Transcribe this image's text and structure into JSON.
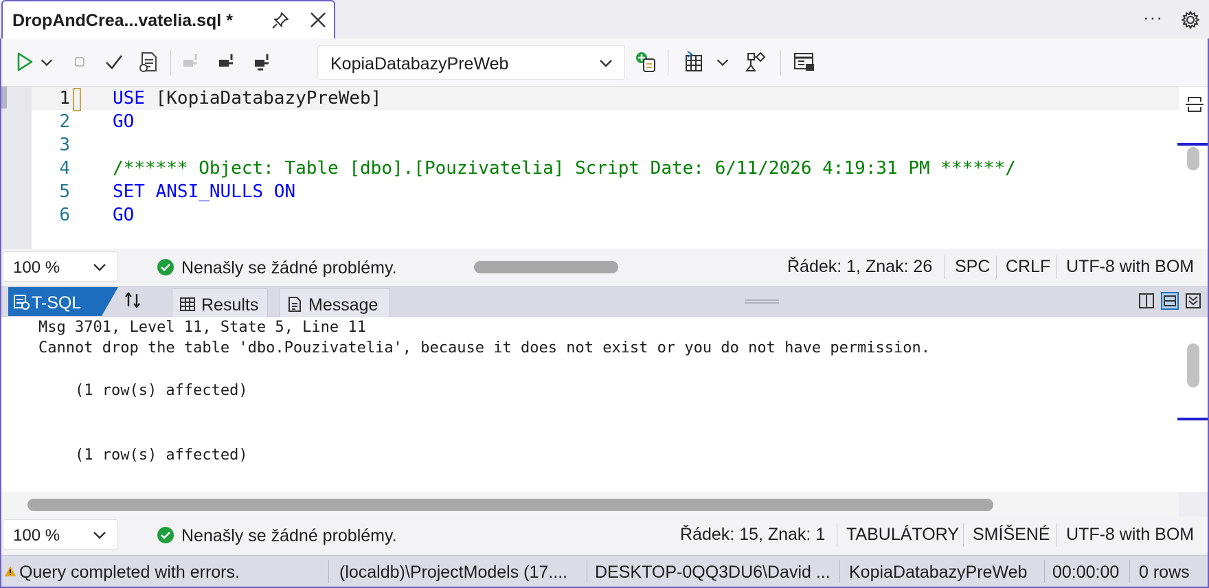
{
  "tab": {
    "title": "DropAndCrea...vatelia.sql *",
    "pin_icon": "pin-icon",
    "close_icon": "close-icon"
  },
  "window_actions": {
    "more": "···",
    "settings_icon": "gear-icon"
  },
  "toolbar": {
    "database": "KopiaDatabazyPreWeb",
    "icons": [
      "execute-icon",
      "execute-dropdown-icon",
      "stop-icon",
      "check-icon",
      "estimated-plan-icon",
      "disconnect-icon",
      "connect-icon",
      "change-connection-icon",
      "new-query-icon",
      "results-to-grid-icon",
      "results-dropdown-icon",
      "actual-plan-icon",
      "client-statistics-icon"
    ]
  },
  "editor": {
    "lines": [
      {
        "n": "1",
        "tokens": [
          {
            "t": "USE",
            "c": "kw"
          },
          {
            "t": " [KopiaDatabazyPreWeb]",
            "c": "tx"
          }
        ]
      },
      {
        "n": "2",
        "tokens": [
          {
            "t": "GO",
            "c": "kw"
          }
        ]
      },
      {
        "n": "3",
        "tokens": []
      },
      {
        "n": "4",
        "tokens": [
          {
            "t": "/****** Object: Table [dbo].[Pouzivatelia] Script Date: 6/11/2026 4:19:31 PM ******/",
            "c": "cm"
          }
        ]
      },
      {
        "n": "5",
        "tokens": [
          {
            "t": "SET ANSI_NULLS ON",
            "c": "kw"
          }
        ]
      },
      {
        "n": "6",
        "tokens": [
          {
            "t": "GO",
            "c": "kw"
          }
        ]
      }
    ]
  },
  "editor_status": {
    "zoom": "100 %",
    "problems": "Nenašly se žádné problémy.",
    "position": "Řádek: 1, Znak: 26",
    "whitespace": "SPC",
    "line_ending": "CRLF",
    "encoding": "UTF-8 with BOM"
  },
  "results_tabs": {
    "tsql": "T-SQL",
    "results": "Results",
    "message": "Message"
  },
  "messages": [
    "Msg 3701, Level 11, State 5, Line 11",
    "Cannot drop the table 'dbo.Pouzivatelia', because it does not exist or you do not have permission.",
    "    (1 row(s) affected)",
    "    (1 row(s) affected)"
  ],
  "results_status": {
    "zoom": "100 %",
    "problems": "Nenašly se žádné problémy.",
    "position": "Řádek: 15, Znak: 1",
    "whitespace": "TABULÁTORY",
    "line_ending": "SMÍŠENÉ",
    "encoding": "UTF-8 with BOM"
  },
  "app_status": {
    "state": "Query completed with errors.",
    "server": "(localdb)\\ProjectModels (17....",
    "user": "DESKTOP-0QQ3DU6\\David ...",
    "database": "KopiaDatabazyPreWeb",
    "elapsed": "00:00:00",
    "rows": "0 rows"
  },
  "colors": {
    "accent": "#6b5fc9",
    "keyword": "#0000ff",
    "comment": "#008000",
    "tsql_tab": "#1e6ebf",
    "ok": "#1e9e3c",
    "warning": "#e8a317"
  }
}
